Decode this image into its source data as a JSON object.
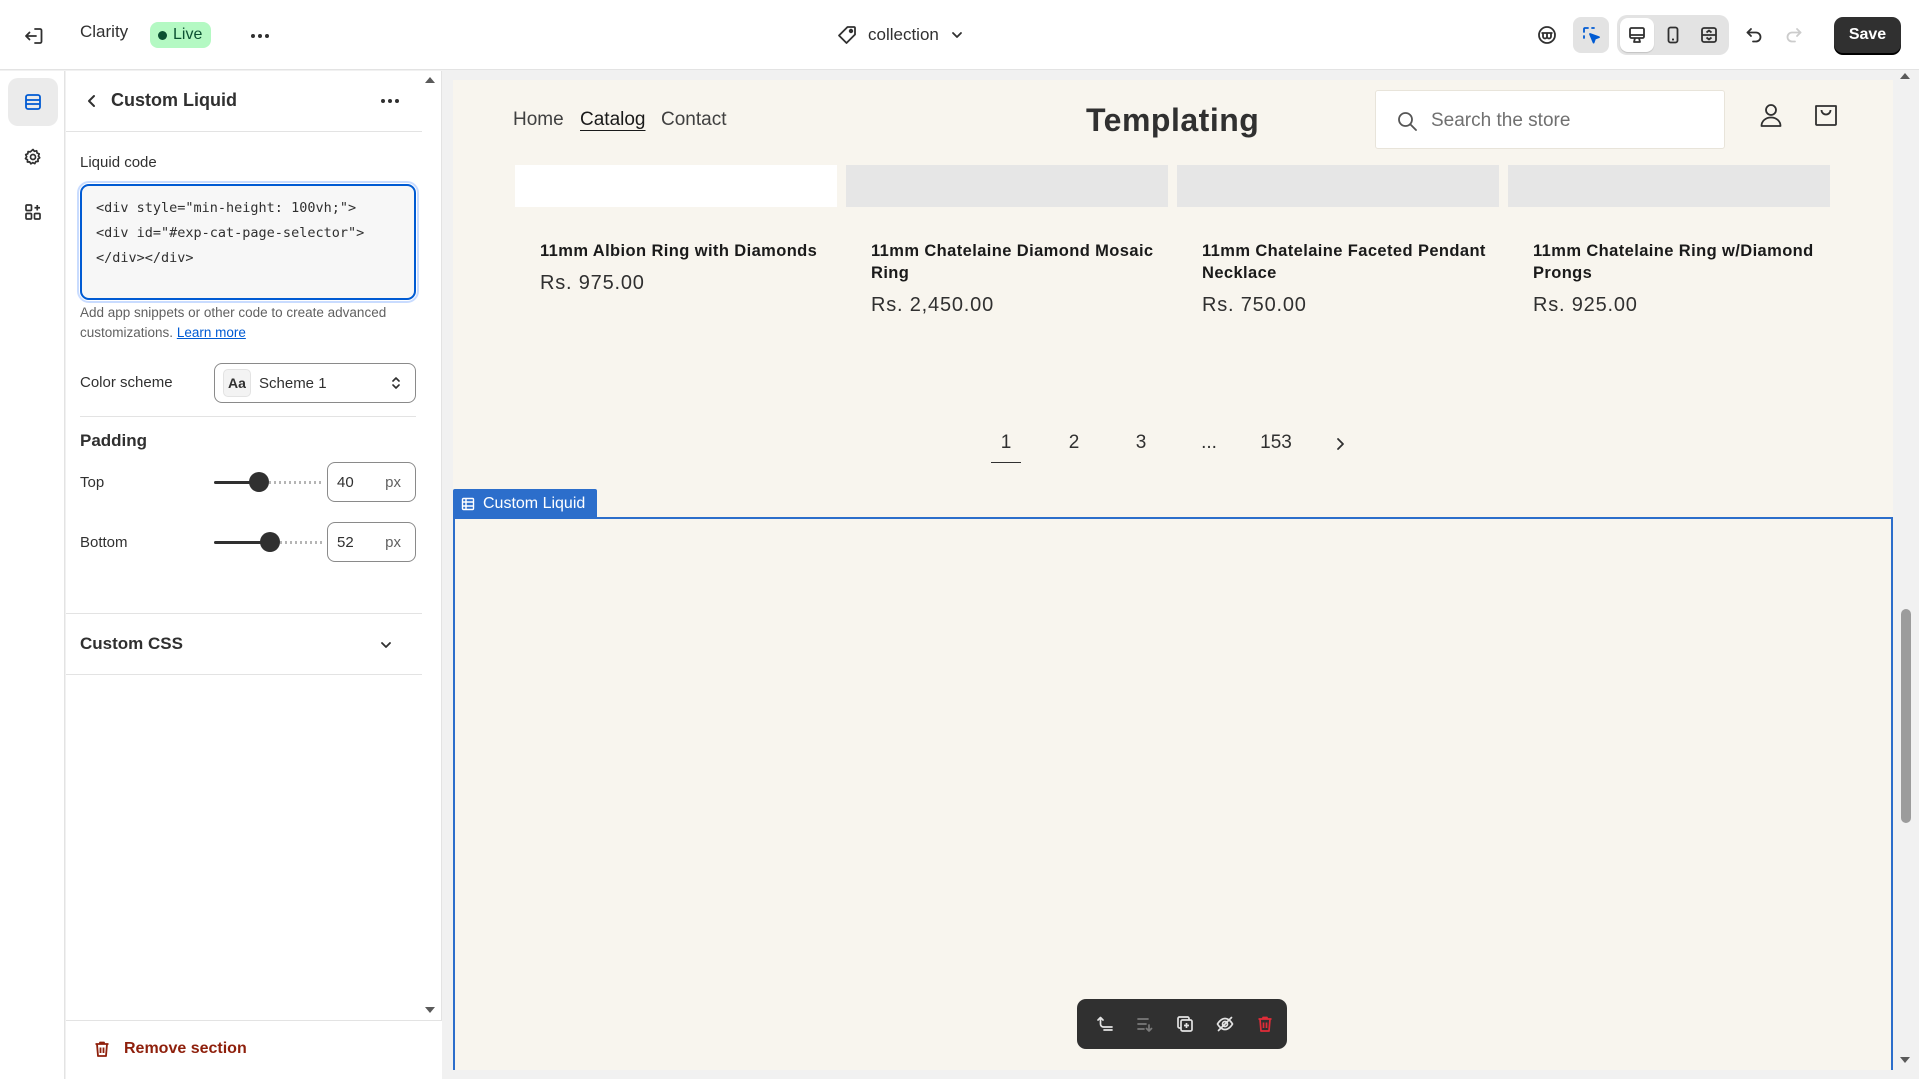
{
  "topbar": {
    "app_title": "Clarity",
    "status_badge": "Live",
    "template_name": "collection",
    "save_label": "Save"
  },
  "panel": {
    "title": "Custom Liquid",
    "liquid_code_label": "Liquid code",
    "liquid_code_value": "<div style=\"min-height: 100vh;\">\n<div id=\"#exp-cat-page-selector\">\n</div></div>",
    "help_text": "Add app snippets or other code to create advanced customizations.",
    "help_link": "Learn more",
    "color_scheme_label": "Color scheme",
    "color_scheme_value": "Scheme 1",
    "color_scheme_swatch": "Aa",
    "padding_heading": "Padding",
    "padding_top_label": "Top",
    "padding_top_value": "40",
    "padding_top_level": 0.4,
    "padding_bottom_label": "Bottom",
    "padding_bottom_value": "52",
    "padding_bottom_level": 0.52,
    "unit": "px",
    "custom_css_label": "Custom CSS",
    "remove_section_label": "Remove section"
  },
  "store": {
    "nav": [
      "Home",
      "Catalog",
      "Contact"
    ],
    "logo": "Templating",
    "search_placeholder": "Search the store",
    "products": [
      {
        "name": "11mm Albion Ring with Diamonds",
        "price": "Rs. 975.00"
      },
      {
        "name": "11mm Chatelaine Diamond Mosaic Ring",
        "price": "Rs. 2,450.00"
      },
      {
        "name": "11mm Chatelaine Faceted Pendant Necklace",
        "price": "Rs. 750.00"
      },
      {
        "name": "11mm Chatelaine Ring w/Diamond Prongs",
        "price": "Rs. 925.00"
      }
    ],
    "pagination": [
      "1",
      "2",
      "3",
      "...",
      "153"
    ],
    "section_tag": "Custom Liquid"
  },
  "colors": {
    "accent": "#2c6ecb",
    "primary_button": "#303030",
    "live_badge": "#b4f9c3",
    "danger": "#8e1f0b",
    "store_background": "#f8f5ee"
  }
}
